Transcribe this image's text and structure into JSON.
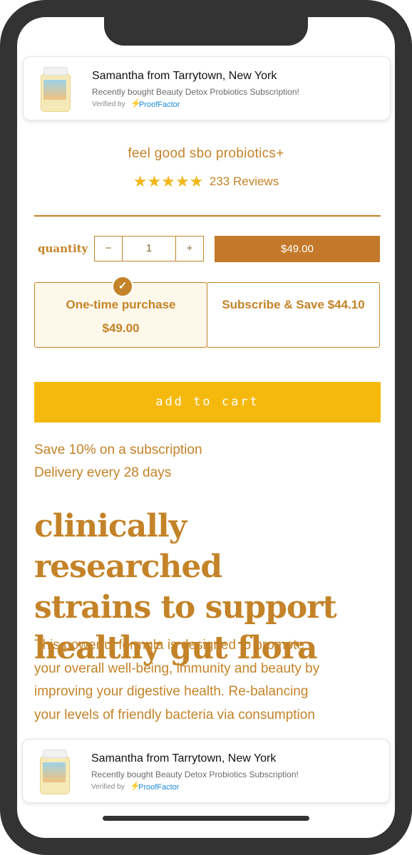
{
  "notification": {
    "name": "Samantha from Tarrytown, New York",
    "description": "Recently bought Beauty Detox Probiotics Subscription!",
    "verified_prefix": "Verified by",
    "verified_brand": "ProofFactor",
    "icon": "lightning-bolt-icon"
  },
  "product": {
    "title": "feel good sbo probiotics+",
    "rating_stars": 5,
    "stars_text": "★★★★★",
    "reviews": "233 Reviews"
  },
  "quantity": {
    "label": "quantity",
    "minus": "−",
    "value": "1",
    "plus": "+",
    "price": "$49.00"
  },
  "purchase_options": [
    {
      "title": "One-time purchase",
      "price": "$49.00",
      "selected": true
    },
    {
      "title": "Subscribe & Save $44.10",
      "price": "",
      "selected": false
    }
  ],
  "add_to_cart": "add to cart",
  "subscription_info": {
    "save": "Save 10% on a subscription",
    "delivery": "Delivery every 28 days"
  },
  "headline": [
    "clinically researched",
    "strains to support",
    "healthy gut flora"
  ],
  "description_lines": [
    "This powerful formula is designed to promote",
    "your overall well-being, immunity and beauty by",
    "improving your digestive health. Re-balancing",
    "your levels of friendly bacteria via consumption"
  ],
  "colors": {
    "accent": "#c48328",
    "button_yellow": "#f5b90e",
    "price_button": "#c4792a",
    "star": "#f2b61b",
    "frame": "#333333"
  }
}
